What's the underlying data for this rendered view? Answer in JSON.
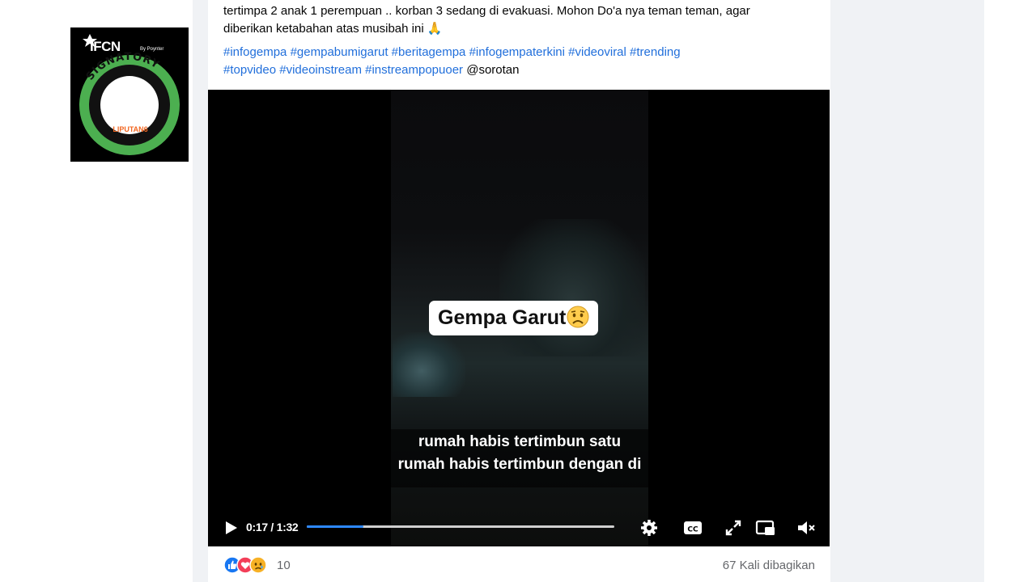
{
  "badge": {
    "brand": "IFCN",
    "sub_brand": "By Poynter",
    "ring_text": "SIGNATORY",
    "center_logo": "LIPUTAN6",
    "colors": {
      "ring": "#4caf50",
      "background": "#000000",
      "logo": "#f26722"
    }
  },
  "post": {
    "text_line1": "tertimpa 2 anak 1 perempuan .. korban 3 sedang di evakuasi. Mohon Do'a nya teman teman, agar",
    "text_line2": "diberikan ketabahan atas musibah ini",
    "text_emoji": "🙏",
    "hashtags": [
      "#infogempa",
      "#gempabumigarut",
      "#beritagempa",
      "#infogempaterkini",
      "#videoviral",
      "#trending",
      "#topvideo",
      "#videoinstream",
      "#instreampopuoer"
    ],
    "mention": "@sorotan"
  },
  "video": {
    "overlay_title": "Gempa Garut",
    "overlay_emoji": "sad-face-icon",
    "subtitle_line1": "rumah habis tertimbun satu",
    "subtitle_line2": "rumah habis tertimbun dengan di",
    "time_display": "0:17 / 1:32",
    "current_seconds": 17,
    "total_seconds": 92,
    "progress_fraction": 0.185,
    "colors": {
      "progress": "#2d88ff"
    },
    "icons": [
      "play-icon",
      "settings-gear-icon",
      "closed-captions-icon",
      "fullscreen-icon",
      "picture-in-picture-icon",
      "volume-muted-icon"
    ]
  },
  "footer": {
    "reaction_icons": [
      "like-icon",
      "love-icon",
      "sad-icon"
    ],
    "reaction_count": "10",
    "shares": "67 Kali dibagikan"
  }
}
